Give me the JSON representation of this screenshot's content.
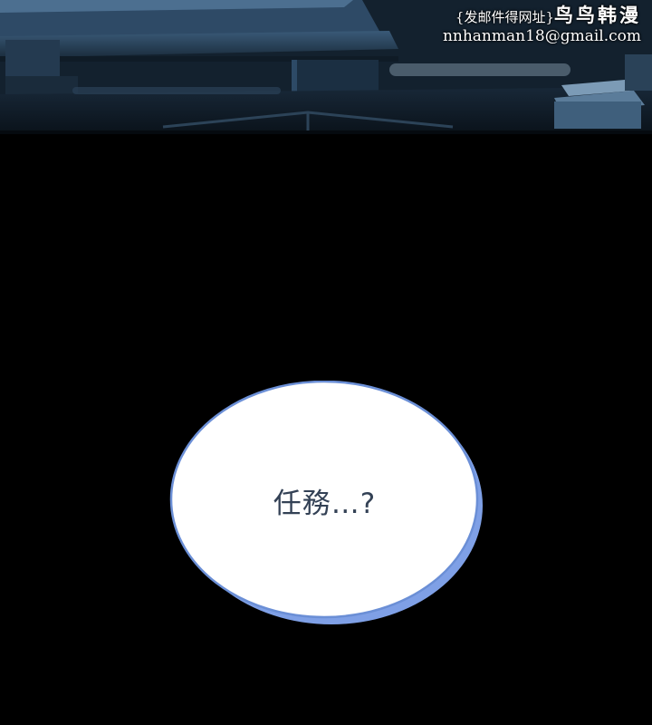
{
  "watermark": {
    "line1_prefix": "{发邮件得网址}",
    "line1_brand": "鸟鸟韩漫",
    "line2": "nnhanman18@gmail.com"
  },
  "speech_bubble": {
    "text": "任務…?"
  },
  "colors": {
    "background": "#000000",
    "top_panel": "#1d3042",
    "bubble_fill": "#ffffff",
    "bubble_outline": "#6b8fd6",
    "bubble_shadow": "#7fa0e6",
    "text": "#334155"
  }
}
